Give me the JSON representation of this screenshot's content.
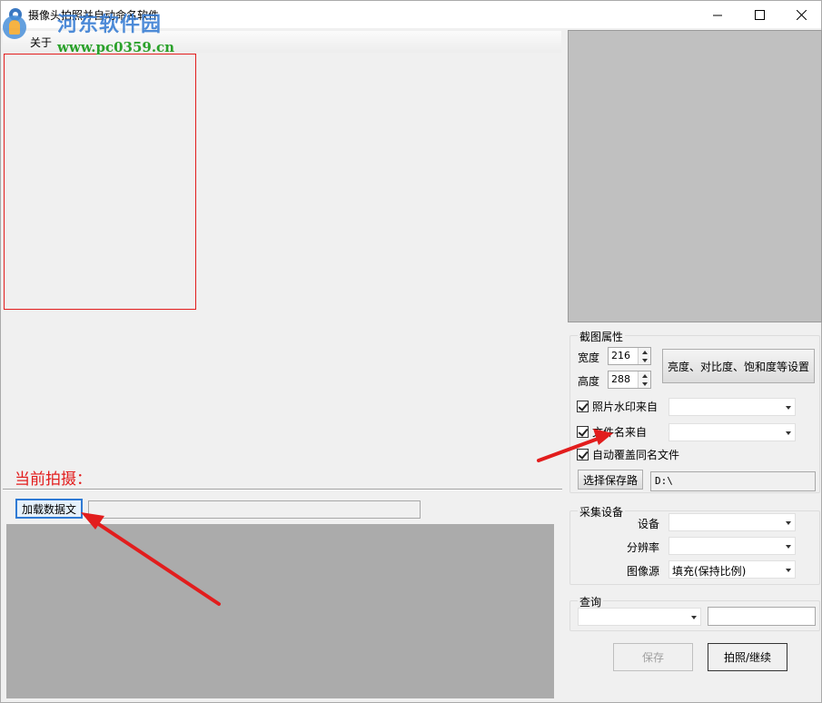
{
  "window": {
    "title": "摄像头拍照并自动命名软件",
    "minimize_symbol": "—",
    "maximize_symbol": "☐",
    "close_symbol": "✕"
  },
  "watermark": {
    "title": "河东软件园",
    "url": "www.pc0359.cn"
  },
  "menu": {
    "items": [
      "关于"
    ]
  },
  "preview": {
    "current_shot_label": "当前拍摄："
  },
  "bottom": {
    "load_button": "加载数据文",
    "path_value": ""
  },
  "crop": {
    "group_title": "截图属性",
    "width_label": "宽度",
    "width_value": "216",
    "height_label": "高度",
    "height_value": "288",
    "adjust_button": "亮度、对比度、饱和度等设置",
    "watermark_from_label": "照片水印来自",
    "watermark_from_checked": true,
    "watermark_from_value": "",
    "filename_from_label": "文件名来自",
    "filename_from_checked": true,
    "filename_from_value": "",
    "overwrite_label": "自动覆盖同名文件",
    "overwrite_checked": true,
    "choose_path_button": "选择保存路",
    "save_path_value": "D:\\"
  },
  "device": {
    "group_title": "采集设备",
    "device_label": "设备",
    "device_value": "",
    "resolution_label": "分辨率",
    "resolution_value": "",
    "image_source_label": "图像源",
    "image_source_value": "填充(保持比例)"
  },
  "query": {
    "group_title": "查询",
    "field_value": "",
    "text_value": ""
  },
  "actions": {
    "save_button": "保存",
    "shoot_button": "拍照/继续"
  },
  "colors": {
    "annotation_red": "#e21d1d",
    "selection_blue": "#2f7ad4"
  }
}
